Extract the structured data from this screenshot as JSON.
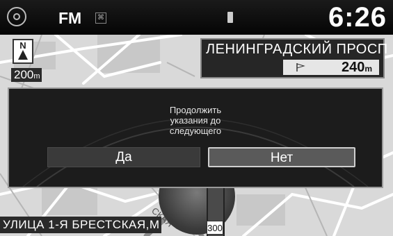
{
  "status_bar": {
    "source": "FM",
    "clock": "6:26",
    "icons": [
      "home-icon",
      "rds-icon",
      "usb-icon"
    ]
  },
  "map": {
    "compass_letter": "N",
    "scale_value": "200",
    "scale_unit": "m",
    "next_street": "ЛЕНИНГРАДСКИЙ ПРОСП",
    "distance_value": "240",
    "distance_unit": "m",
    "current_street": "УЛИЦА 1-Я БРЕСТСКАЯ,М",
    "road_number": "300",
    "map_label_partial": "СКАЯ"
  },
  "dialog": {
    "message_line1": "Продолжить",
    "message_line2": "указания до",
    "message_line3": "следующего",
    "yes_label": "Да",
    "no_label": "Нет"
  },
  "colors": {
    "status_bar": "#0a0a0a",
    "dialog_bg": "#1c1c1c",
    "map_bg": "#d6d6d6",
    "selected_button_border": "#cfcfcf"
  }
}
